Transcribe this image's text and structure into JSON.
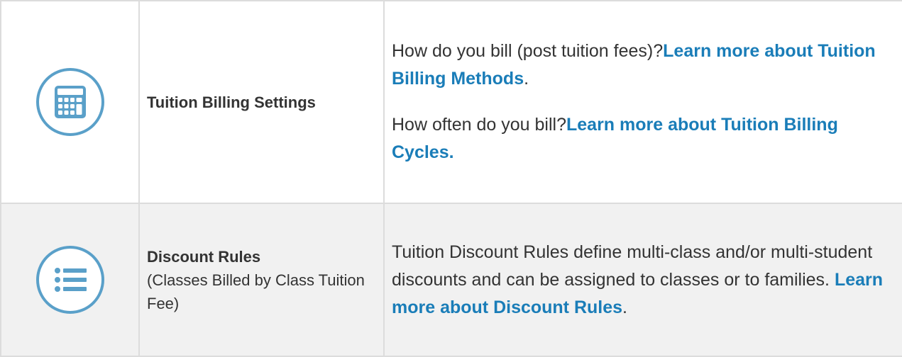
{
  "colors": {
    "link": "#1a7db8",
    "icon": "#5aa0c9",
    "border": "#dcdcdc",
    "row_alt": "#f1f1f1"
  },
  "rows": [
    {
      "icon": "calculator-icon",
      "title": "Tuition Billing Settings",
      "desc1_text": "How do you bill (post tuition fees)?",
      "desc1_link": "Learn more about Tuition Billing Methods",
      "desc1_after": ".",
      "desc2_text": "How often do you bill?",
      "desc2_link": "Learn more about Tuition Billing Cycles."
    },
    {
      "icon": "list-icon",
      "title": "Discount Rules",
      "subtitle": "(Classes Billed by Class Tuition Fee)",
      "desc_text": "Tuition Discount Rules define multi-class and/or multi-student discounts and can be assigned to classes or to families. ",
      "desc_link": "Learn more about Discount Rules",
      "desc_after": "."
    }
  ]
}
